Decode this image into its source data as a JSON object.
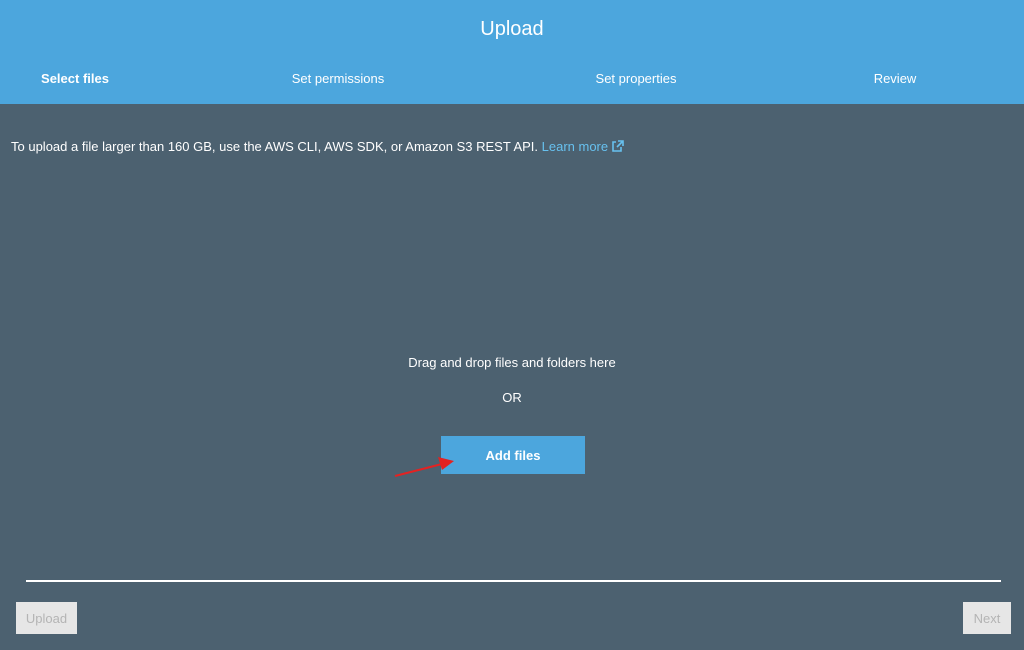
{
  "header": {
    "title": "Upload",
    "steps": [
      {
        "label": "Select files",
        "active": true
      },
      {
        "label": "Set permissions",
        "active": false
      },
      {
        "label": "Set properties",
        "active": false
      },
      {
        "label": "Review",
        "active": false
      }
    ]
  },
  "notice": {
    "text": "To upload a file larger than 160 GB, use the AWS CLI, AWS SDK, or Amazon S3 REST API. ",
    "link_label": "Learn more",
    "link_icon": "external-link-icon"
  },
  "dropzone": {
    "instruction": "Drag and drop files and folders here",
    "separator": "OR",
    "add_files_label": "Add files"
  },
  "footer": {
    "upload_label": "Upload",
    "next_label": "Next"
  },
  "colors": {
    "header_bg": "#4ca6dd",
    "body_bg": "#4c6170",
    "link": "#67c1ef",
    "annotation_arrow": "#e32222",
    "disabled_button_bg": "#e6e6e6",
    "disabled_button_text": "#b4b4b4"
  }
}
